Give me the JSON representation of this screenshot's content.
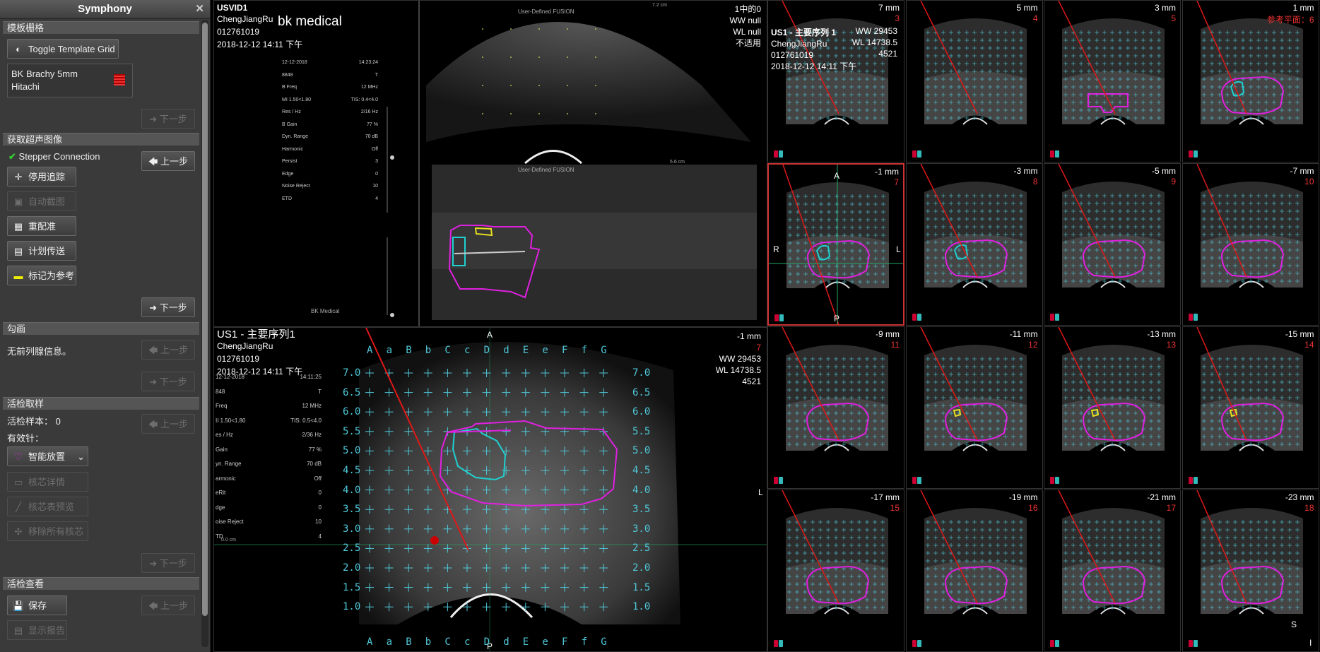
{
  "app": {
    "title": "Symphony"
  },
  "sidebar": {
    "template_section": "模板栅格",
    "toggle_grid": "Toggle Template Grid",
    "template_name_line1": "BK Brachy 5mm",
    "template_name_line2": "Hitachi",
    "next": "下一步",
    "acquire_section": "获取超声图像",
    "stepper": "Stepper Connection",
    "prev": "上一步",
    "stop_tracking": "停用追踪",
    "auto_capture": "自动截图",
    "reregister": "重配准",
    "plan_transfer": "计划传送",
    "mark_reference": "标记为参考",
    "contour_section": "勾画",
    "no_prostate_info": "无前列腺信息。",
    "biopsy_section": "活检取样",
    "biopsy_samples": "活检样本：",
    "biopsy_count": "0",
    "active_needle": "有效针：",
    "smart_place": "智能放置",
    "core_detail": "核芯详情",
    "core_overview": "核芯表预览",
    "remove_all_cores": "移除所有核芯",
    "review_section": "活检查看",
    "save": "保存",
    "show_report": "显示报告"
  },
  "us_video": {
    "series": "USVID1",
    "patient": "ChengJiangRu",
    "id": "012761019",
    "datetime": "2018-12-12 14:11 下午",
    "brand": "bk medical",
    "frame": "1中的0",
    "ww": "WW null",
    "wl": "WL null",
    "na": "不适用",
    "params": [
      [
        "12-12-2018",
        "14:23:24"
      ],
      [
        "8848",
        "T"
      ],
      [
        "B Freq",
        "12 MHz"
      ],
      [
        "MI 1.50<1.80",
        "TIS: 0.4<4.0"
      ],
      [
        "Res / Hz",
        "2/16 Hz"
      ],
      [
        "B Gain",
        "77 %"
      ],
      [
        "Dyn. Range",
        "70 dB"
      ],
      [
        "Harmonic",
        "Off"
      ],
      [
        "Persist",
        "3"
      ],
      [
        "Edge",
        "0"
      ],
      [
        "Noise Reject",
        "10"
      ],
      [
        "ETD",
        "4"
      ]
    ],
    "top_caption": "User-Defined FUSION",
    "bottom_caption": "User-Defined FUSION",
    "footer": "BK Medical"
  },
  "axial_view": {
    "series": "US1 - 主要序列1",
    "patient": "ChengJiangRu",
    "id": "012761019",
    "datetime": "2018-12-12 14:11 下午",
    "mm": "-1 mm",
    "index": "7",
    "ww": "WW 29453",
    "wl": "WL 14738.5",
    "extra": "4521",
    "anterior": "A",
    "posterior": "P",
    "left": "L",
    "cols": [
      "A",
      "a",
      "B",
      "b",
      "C",
      "c",
      "D",
      "d",
      "E",
      "e",
      "F",
      "f",
      "G"
    ],
    "rows": [
      "7.0",
      "6.5",
      "6.0",
      "5.5",
      "5.0",
      "4.5",
      "4.0",
      "3.5",
      "3.0",
      "2.5",
      "2.0",
      "1.5",
      "1.0"
    ],
    "params": [
      [
        "12-12-2018",
        "14:11:25"
      ],
      [
        "848",
        "T"
      ],
      [
        "Freq",
        "12 MHz"
      ],
      [
        "II 1.50<1.80",
        "TIS: 0.5<4.0"
      ],
      [
        "es / Hz",
        "2/36 Hz"
      ],
      [
        "Gain",
        "77 %"
      ],
      [
        "yn. Range",
        "70 dB"
      ],
      [
        "armonic",
        "Off"
      ],
      [
        "eRit",
        "0"
      ],
      [
        "dge",
        "0"
      ],
      [
        "oise Reject",
        "10"
      ],
      [
        "TD",
        "4"
      ]
    ]
  },
  "series_header": {
    "series": "US1 - 主要序列 1",
    "patient": "ChengJiangRu",
    "id": "012761019",
    "datetime": "2018-12-12 14:11 下午",
    "ww": "WW 29453",
    "wl": "WL 14738.5",
    "extra": "4521",
    "ref_plane": "参考平面：6"
  },
  "tiles": [
    {
      "mm": "7 mm",
      "idx": "3"
    },
    {
      "mm": "5 mm",
      "idx": "4"
    },
    {
      "mm": "3 mm",
      "idx": "5"
    },
    {
      "mm": "1 mm",
      "idx": "参考平面：6"
    },
    {
      "mm": "-1 mm",
      "idx": "7"
    },
    {
      "mm": "-3 mm",
      "idx": "8"
    },
    {
      "mm": "-5 mm",
      "idx": "9"
    },
    {
      "mm": "-7 mm",
      "idx": "10"
    },
    {
      "mm": "-9 mm",
      "idx": "11"
    },
    {
      "mm": "-11 mm",
      "idx": "12"
    },
    {
      "mm": "-13 mm",
      "idx": "13"
    },
    {
      "mm": "-15 mm",
      "idx": "14"
    },
    {
      "mm": "-17 mm",
      "idx": "15"
    },
    {
      "mm": "-19 mm",
      "idx": "16"
    },
    {
      "mm": "-21 mm",
      "idx": "17"
    },
    {
      "mm": "-23 mm",
      "idx": "18"
    }
  ],
  "selected_tile_orient": {
    "a": "A",
    "p": "P",
    "r": "R",
    "l": "L"
  },
  "corner_labels": {
    "s": "S",
    "i": "I"
  },
  "colors": {
    "prostate": "#e020e0",
    "lesion": "#20d0d0",
    "target": "#e8e020",
    "needle": "#e01818",
    "grid": "#4fc8d8",
    "selected": "#c33"
  }
}
